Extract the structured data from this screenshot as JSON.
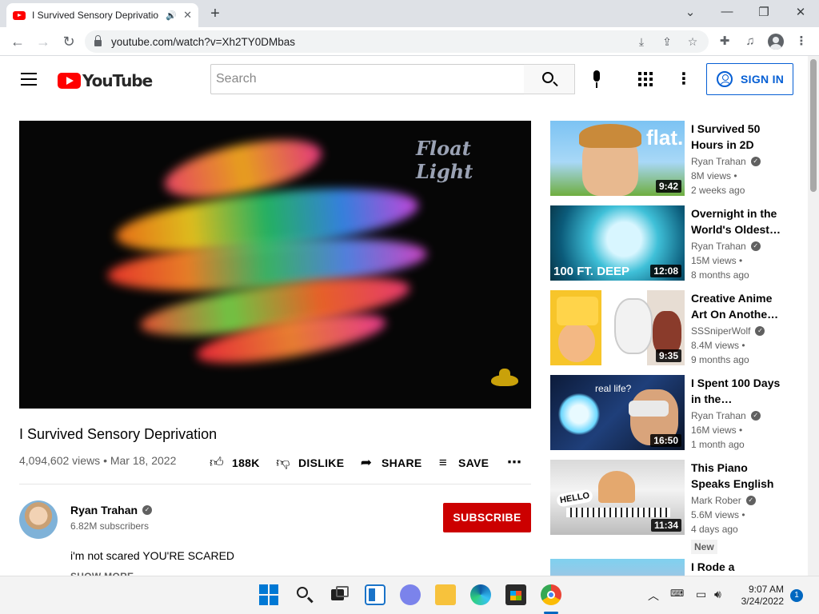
{
  "browser": {
    "tab_title": "I Survived Sensory Deprivatio",
    "url": "youtube.com/watch?v=Xh2TY0DMbas"
  },
  "header": {
    "logo_text": "YouTube",
    "search_placeholder": "Search",
    "signin_label": "SIGN IN"
  },
  "player": {
    "watermark": "Float Light"
  },
  "video": {
    "title": "I Survived Sensory Deprivation",
    "meta": "4,094,602 views • Mar 18, 2022",
    "likes": "188K",
    "dislike_label": "DISLIKE",
    "share_label": "SHARE",
    "save_label": "SAVE",
    "channel": "Ryan Trahan",
    "subscribers": "6.82M subscribers",
    "subscribe_label": "SUBSCRIBE",
    "description": "i'm not scared YOU'RE SCARED",
    "show_more": "SHOW MORE"
  },
  "recommendations": [
    {
      "title": "I Survived 50 Hours in 2D",
      "channel": "Ryan Trahan",
      "views": "8M views •",
      "age": "2 weeks ago",
      "duration": "9:42",
      "thumb_text": "flat."
    },
    {
      "title": "Overnight in the World's Oldest…",
      "channel": "Ryan Trahan",
      "views": "15M views •",
      "age": "8 months ago",
      "duration": "12:08",
      "thumb_text": "100 FT. DEEP"
    },
    {
      "title": "Creative Anime Art On Anothe…",
      "channel": "SSSniperWolf",
      "views": "8.4M views •",
      "age": "9 months ago",
      "duration": "9:35",
      "thumb_text": ""
    },
    {
      "title": "I Spent 100 Days in the…",
      "channel": "Ryan Trahan",
      "views": "16M views •",
      "age": "1 month ago",
      "duration": "16:50",
      "thumb_text": "real life?"
    },
    {
      "title": "This Piano Speaks English",
      "channel": "Mark Rober",
      "views": "5.6M views •",
      "age": "4 days ago",
      "duration": "11:34",
      "thumb_text": "HELLO",
      "badge": "New"
    },
    {
      "title": "I Rode a",
      "channel": "",
      "views": "",
      "age": "",
      "duration": "",
      "thumb_text": ""
    }
  ],
  "taskbar": {
    "time": "9:07 AM",
    "date": "3/24/2022",
    "notification_count": "1"
  },
  "colors": {
    "youtube_red": "#ff0000",
    "subscribe_red": "#cc0000",
    "link_blue": "#065fd4"
  }
}
